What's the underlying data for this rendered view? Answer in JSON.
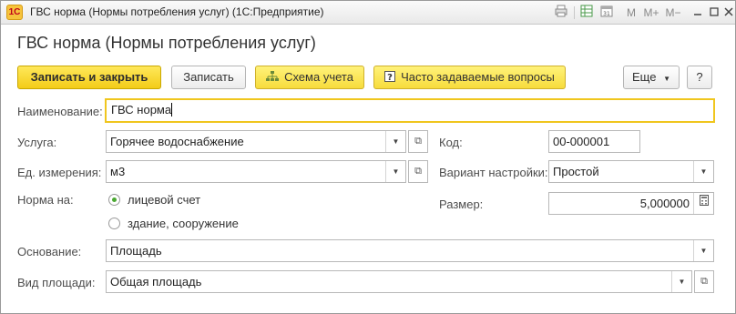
{
  "window": {
    "title": "ГВС норма (Нормы потребления услуг)  (1С:Предприятие)",
    "logo_text": "1С"
  },
  "titlebar_icons": [
    "print-icon",
    "table-icon",
    "calendar-icon",
    "memory-icon",
    "memory-plus-icon",
    "memory-minus-icon",
    "minimize-icon",
    "maximize-icon",
    "close-icon"
  ],
  "form": {
    "title": "ГВС норма (Нормы потребления услуг)"
  },
  "toolbar": {
    "save_close_label": "Записать и закрыть",
    "save_label": "Записать",
    "scheme_label": "Схема учета",
    "faq_label": "Часто задаваемые вопросы",
    "more_label": "Еще",
    "help_label": "?"
  },
  "fields": {
    "name_label": "Наименование:",
    "name_value": "ГВС норма",
    "service_label": "Услуга:",
    "service_value": "Горячее водоснабжение",
    "unit_label": "Ед. измерения:",
    "unit_value": "м3",
    "norm_label": "Норма на:",
    "norm_options": [
      "лицевой счет",
      "здание, сооружение"
    ],
    "norm_selected": 0,
    "basis_label": "Основание:",
    "basis_value": "Площадь",
    "area_label": "Вид площади:",
    "area_value": "Общая площадь",
    "code_label": "Код:",
    "code_value": "00-000001",
    "variant_label": "Вариант настройки:",
    "variant_value": "Простой",
    "size_label": "Размер:",
    "size_value": "5,000000"
  },
  "colors": {
    "primary_button": "#f3cc18",
    "focus_border": "#f0c61e",
    "radio_on": "#4aa832"
  }
}
